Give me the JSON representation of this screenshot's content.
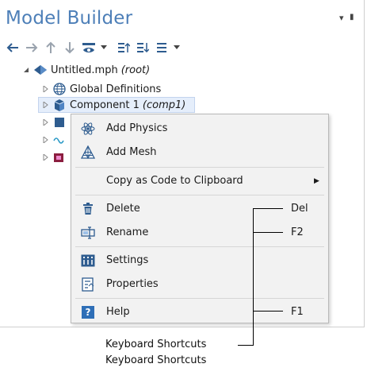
{
  "panel": {
    "title": "Model Builder",
    "title_controls": [
      "▾",
      "▮"
    ],
    "toolbar": [
      "arrow-left-icon",
      "arrow-right-icon",
      "arrow-up-icon",
      "arrow-down-icon",
      "eye-filter-icon",
      "dropdown-icon",
      "expand-all-icon",
      "collapse-all-icon",
      "list-options-icon",
      "dropdown-icon"
    ]
  },
  "tree": {
    "root": {
      "label": "Untitled.mph",
      "suffix": "(root)"
    },
    "global_definitions": {
      "label": "Global Definitions"
    },
    "component": {
      "label": "Component 1",
      "suffix": "(comp1)"
    }
  },
  "context_menu": {
    "items": [
      {
        "label": "Add Physics",
        "icon": "physics-icon",
        "shortcut": ""
      },
      {
        "label": "Add Mesh",
        "icon": "mesh-icon",
        "shortcut": ""
      },
      {
        "label": "Copy as Code to Clipboard",
        "icon": "",
        "shortcut": "",
        "submenu_arrow": "▶"
      },
      {
        "label": "Delete",
        "icon": "trash-icon",
        "shortcut": "Del"
      },
      {
        "label": "Rename",
        "icon": "rename-icon",
        "shortcut": "F2"
      },
      {
        "label": "Settings",
        "icon": "settings-icon",
        "shortcut": ""
      },
      {
        "label": "Properties",
        "icon": "properties-icon",
        "shortcut": ""
      },
      {
        "label": "Help",
        "icon": "help-icon",
        "shortcut": "F1",
        "icon_glyph": "?"
      }
    ]
  },
  "annotation": {
    "label": "Keyboard Shortcuts"
  },
  "colors": {
    "title": "#4d7fb8",
    "menu_bg": "#f2f2f2",
    "help_icon": "#2f6fb7"
  }
}
